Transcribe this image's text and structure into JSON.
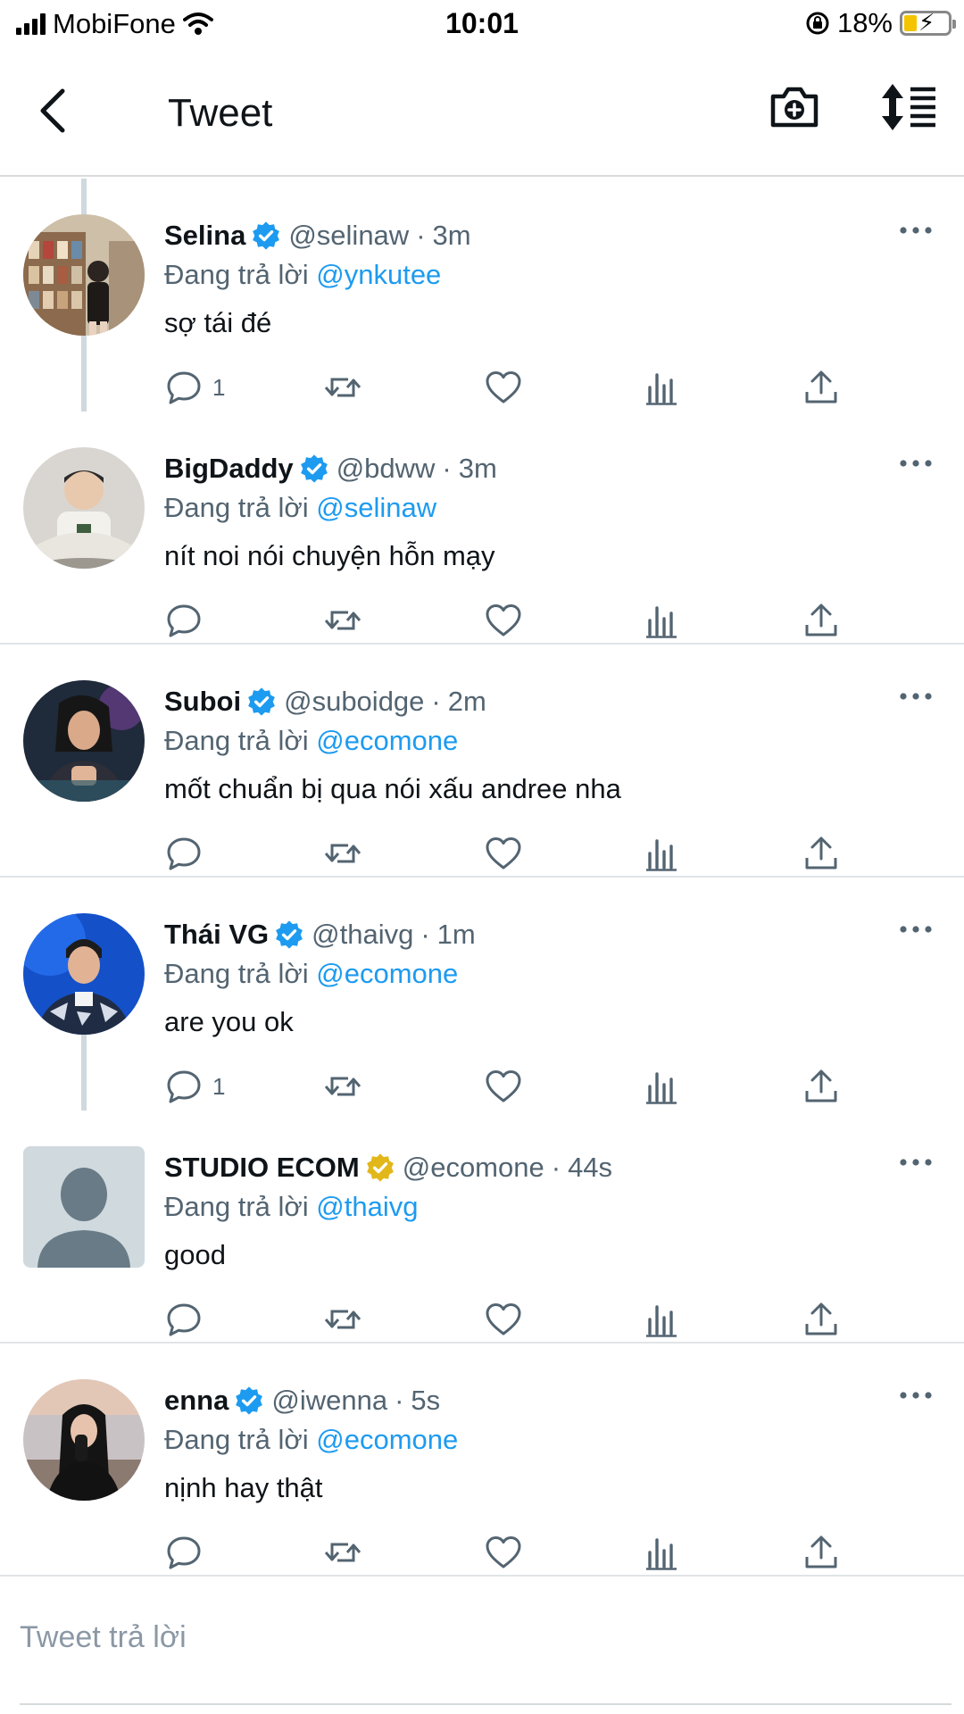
{
  "status_bar": {
    "carrier": "MobiFone",
    "time": "10:01",
    "battery": "18%"
  },
  "header": {
    "title": "Tweet"
  },
  "colors": {
    "link": "#1d9bf0",
    "verified_blue": "#1d9bf0",
    "verified_gold": "#e2b719",
    "secondary_text": "#536471"
  },
  "tweets": [
    {
      "name": "Selina",
      "verified": "blue",
      "handle": "@selinaw",
      "dot": "·",
      "time": "3m",
      "reply_prefix": "Đang trả lời",
      "reply_to": "@ynkutee",
      "text": "sợ tái đé",
      "reply_count": "1"
    },
    {
      "name": "BigDaddy",
      "verified": "blue",
      "handle": "@bdww",
      "dot": "·",
      "time": "3m",
      "reply_prefix": "Đang trả lời",
      "reply_to": "@selinaw",
      "text": "nít noi nói chuyện hỗn mạy",
      "reply_count": ""
    },
    {
      "name": "Suboi",
      "verified": "blue",
      "handle": "@suboidge",
      "dot": "·",
      "time": "2m",
      "reply_prefix": "Đang trả lời",
      "reply_to": "@ecomone",
      "text": "mốt chuẩn bị qua nói xấu andree nha",
      "reply_count": ""
    },
    {
      "name": "Thái VG",
      "verified": "blue",
      "handle": "@thaivg",
      "dot": "·",
      "time": "1m",
      "reply_prefix": "Đang trả lời",
      "reply_to": "@ecomone",
      "text": "are you ok",
      "reply_count": "1"
    },
    {
      "name": "STUDIO ECOM",
      "verified": "gold",
      "handle": "@ecomone",
      "dot": "·",
      "time": "44s",
      "reply_prefix": "Đang trả lời",
      "reply_to": "@thaivg",
      "text": "good",
      "reply_count": ""
    },
    {
      "name": "enna",
      "verified": "blue",
      "handle": "@iwenna",
      "dot": "·",
      "time": "5s",
      "reply_prefix": "Đang trả lời",
      "reply_to": "@ecomone",
      "text": "nịnh hay thật",
      "reply_count": ""
    }
  ],
  "composer": {
    "placeholder": "Tweet trả lời"
  }
}
